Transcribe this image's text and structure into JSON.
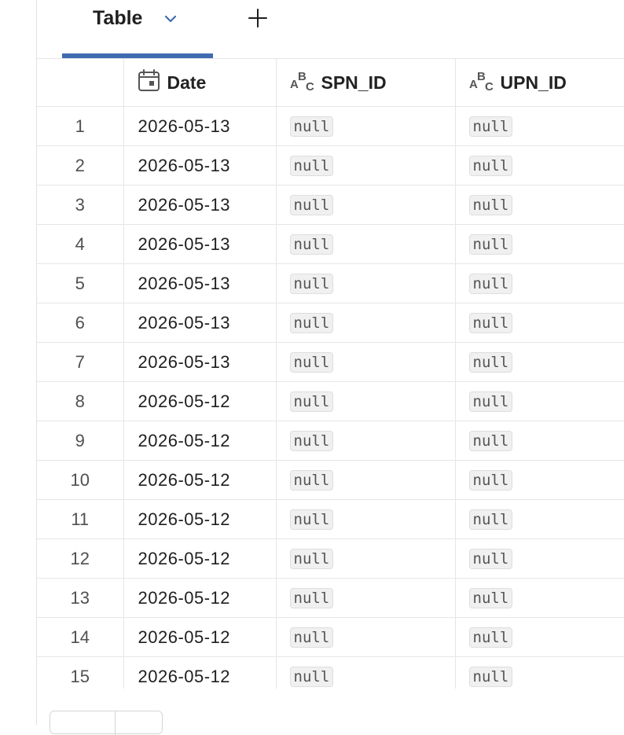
{
  "tabs": {
    "active_label": "Table",
    "add_icon": "plus-icon",
    "dropdown_icon": "chevron-down-icon"
  },
  "colors": {
    "accent": "#3f6bb1"
  },
  "table": {
    "columns": [
      {
        "label": "",
        "icon": ""
      },
      {
        "label": "Date",
        "icon": "calendar-icon"
      },
      {
        "label": "SPN_ID",
        "icon": "string-type-icon"
      },
      {
        "label": "UPN_ID",
        "icon": "string-type-icon"
      }
    ],
    "rows": [
      {
        "index": "1",
        "date": "2026-05-13",
        "spn_id": "null",
        "upn_id": "null"
      },
      {
        "index": "2",
        "date": "2026-05-13",
        "spn_id": "null",
        "upn_id": "null"
      },
      {
        "index": "3",
        "date": "2026-05-13",
        "spn_id": "null",
        "upn_id": "null"
      },
      {
        "index": "4",
        "date": "2026-05-13",
        "spn_id": "null",
        "upn_id": "null"
      },
      {
        "index": "5",
        "date": "2026-05-13",
        "spn_id": "null",
        "upn_id": "null"
      },
      {
        "index": "6",
        "date": "2026-05-13",
        "spn_id": "null",
        "upn_id": "null"
      },
      {
        "index": "7",
        "date": "2026-05-13",
        "spn_id": "null",
        "upn_id": "null"
      },
      {
        "index": "8",
        "date": "2026-05-12",
        "spn_id": "null",
        "upn_id": "null"
      },
      {
        "index": "9",
        "date": "2026-05-12",
        "spn_id": "null",
        "upn_id": "null"
      },
      {
        "index": "10",
        "date": "2026-05-12",
        "spn_id": "null",
        "upn_id": "null"
      },
      {
        "index": "11",
        "date": "2026-05-12",
        "spn_id": "null",
        "upn_id": "null"
      },
      {
        "index": "12",
        "date": "2026-05-12",
        "spn_id": "null",
        "upn_id": "null"
      },
      {
        "index": "13",
        "date": "2026-05-12",
        "spn_id": "null",
        "upn_id": "null"
      },
      {
        "index": "14",
        "date": "2026-05-12",
        "spn_id": "null",
        "upn_id": "null"
      },
      {
        "index": "15",
        "date": "2026-05-12",
        "spn_id": "null",
        "upn_id": "null"
      }
    ]
  }
}
